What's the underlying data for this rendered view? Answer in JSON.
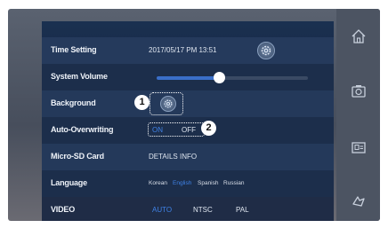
{
  "settings": {
    "time_setting": {
      "label": "Time Setting",
      "value": "2017/05/17  PM 13:51"
    },
    "system_volume": {
      "label": "System Volume",
      "level": 0.4
    },
    "background": {
      "label": "Background"
    },
    "auto_overwriting": {
      "label": "Auto-Overwriting",
      "on": "ON",
      "off": "OFF",
      "selected": "ON"
    },
    "micro_sd": {
      "label": "Micro-SD Card",
      "value": "DETAILS INFO"
    },
    "language": {
      "label": "Language",
      "options": [
        "Korean",
        "English",
        "Spanish",
        "Russian"
      ],
      "selected": "English"
    },
    "video": {
      "label": "VIDEO",
      "options": [
        "AUTO",
        "NTSC",
        "PAL"
      ],
      "selected": "AUTO"
    }
  },
  "callouts": [
    "1",
    "2"
  ],
  "sidebar": {
    "items": [
      {
        "icon": "home-icon"
      },
      {
        "icon": "camera-icon"
      },
      {
        "icon": "monitor-icon"
      },
      {
        "icon": "back-icon"
      }
    ]
  },
  "colors": {
    "accent": "#3f82e6",
    "panel": "#1c2e4b",
    "sidebar": "#4c5462"
  }
}
